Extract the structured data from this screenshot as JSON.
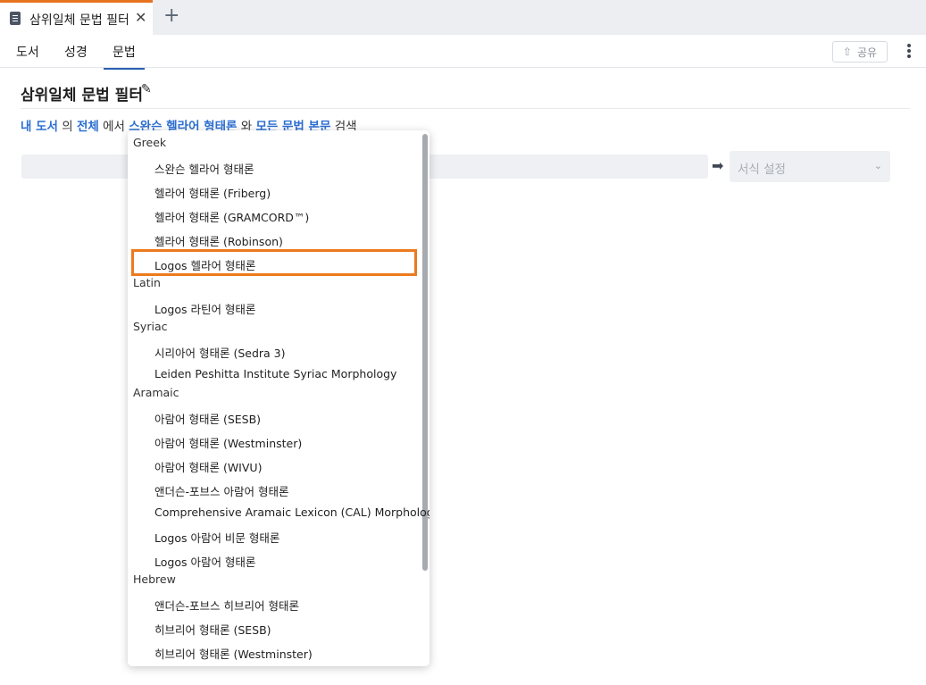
{
  "tab": {
    "title": "삼위일체 문법 필터",
    "close_glyph": "✕",
    "new_tab_glyph": "+"
  },
  "nav": {
    "items": [
      "도서",
      "성경",
      "문법"
    ],
    "share_label": "공유",
    "share_glyph": "⇧"
  },
  "page": {
    "title": "삼위일체 문법 필터",
    "edit_glyph": "✎"
  },
  "sentence": {
    "my_library": "내 도서",
    "w1": "의",
    "all": "전체",
    "w2": "에서",
    "morphology": "스완슨 헬라어 형태론",
    "w3": "와",
    "all_grammar": "모든 문법 본문",
    "w4": "검색"
  },
  "format": {
    "placeholder": "서식 설정",
    "chevron": "⌄"
  },
  "arrow_glyph": "➡",
  "dropdown": {
    "groups": [
      {
        "label": "Greek",
        "options": [
          "스완슨 헬라어 형태론",
          "헬라어 형태론 (Friberg)",
          "헬라어 형태론 (GRAMCORD™)",
          "헬라어 형태론 (Robinson)",
          "Logos 헬라어 형태론"
        ]
      },
      {
        "label": "Latin",
        "options": [
          "Logos 라틴어 형태론"
        ]
      },
      {
        "label": "Syriac",
        "options": [
          "시리아어 형태론 (Sedra 3)",
          "Leiden Peshitta Institute Syriac Morphology"
        ]
      },
      {
        "label": "Aramaic",
        "options": [
          "아람어 형태론 (SESB)",
          "아람어 형태론 (Westminster)",
          "아람어 형태론 (WIVU)",
          "앤더슨-포브스 아람어 형태론",
          "Comprehensive Aramaic Lexicon (CAL) Morphology",
          "Logos 아람어 비문 형태론",
          "Logos 아람어 형태론"
        ]
      },
      {
        "label": "Hebrew",
        "options": [
          "앤더슨-포브스 히브리어 형태론",
          "히브리어 형태론 (SESB)",
          "히브리어 형태론 (Westminster)"
        ]
      }
    ],
    "highlighted": "Logos 헬라어 형태론"
  },
  "colors": {
    "accent": "#2c6fd1",
    "tab_indicator": "#e8731f",
    "highlight_border": "#ec7a1e"
  }
}
